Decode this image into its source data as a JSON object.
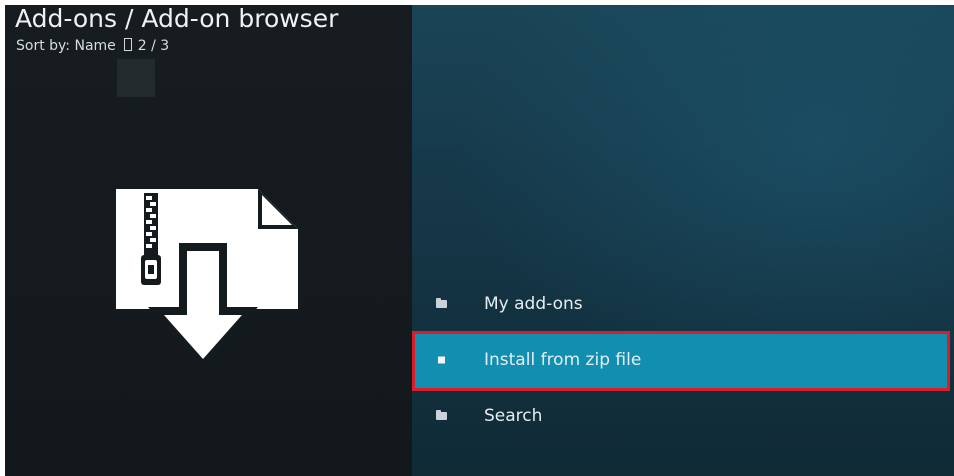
{
  "header": {
    "title": "Add-ons / Add-on browser",
    "sort_label": "Sort by: Name",
    "page_counter": "2 / 3"
  },
  "menu": {
    "items": [
      {
        "label": "My add-ons",
        "icon": "folder-icon",
        "selected": false
      },
      {
        "label": "Install from zip file",
        "icon": "square-icon",
        "selected": true
      },
      {
        "label": "Search",
        "icon": "folder-icon",
        "selected": false
      }
    ]
  },
  "colors": {
    "left_background": "#141b1f",
    "right_background": "#16394a",
    "selected_item": "#128fb0",
    "highlight_frame": "#d81e2a",
    "text": "#e6edf0"
  }
}
